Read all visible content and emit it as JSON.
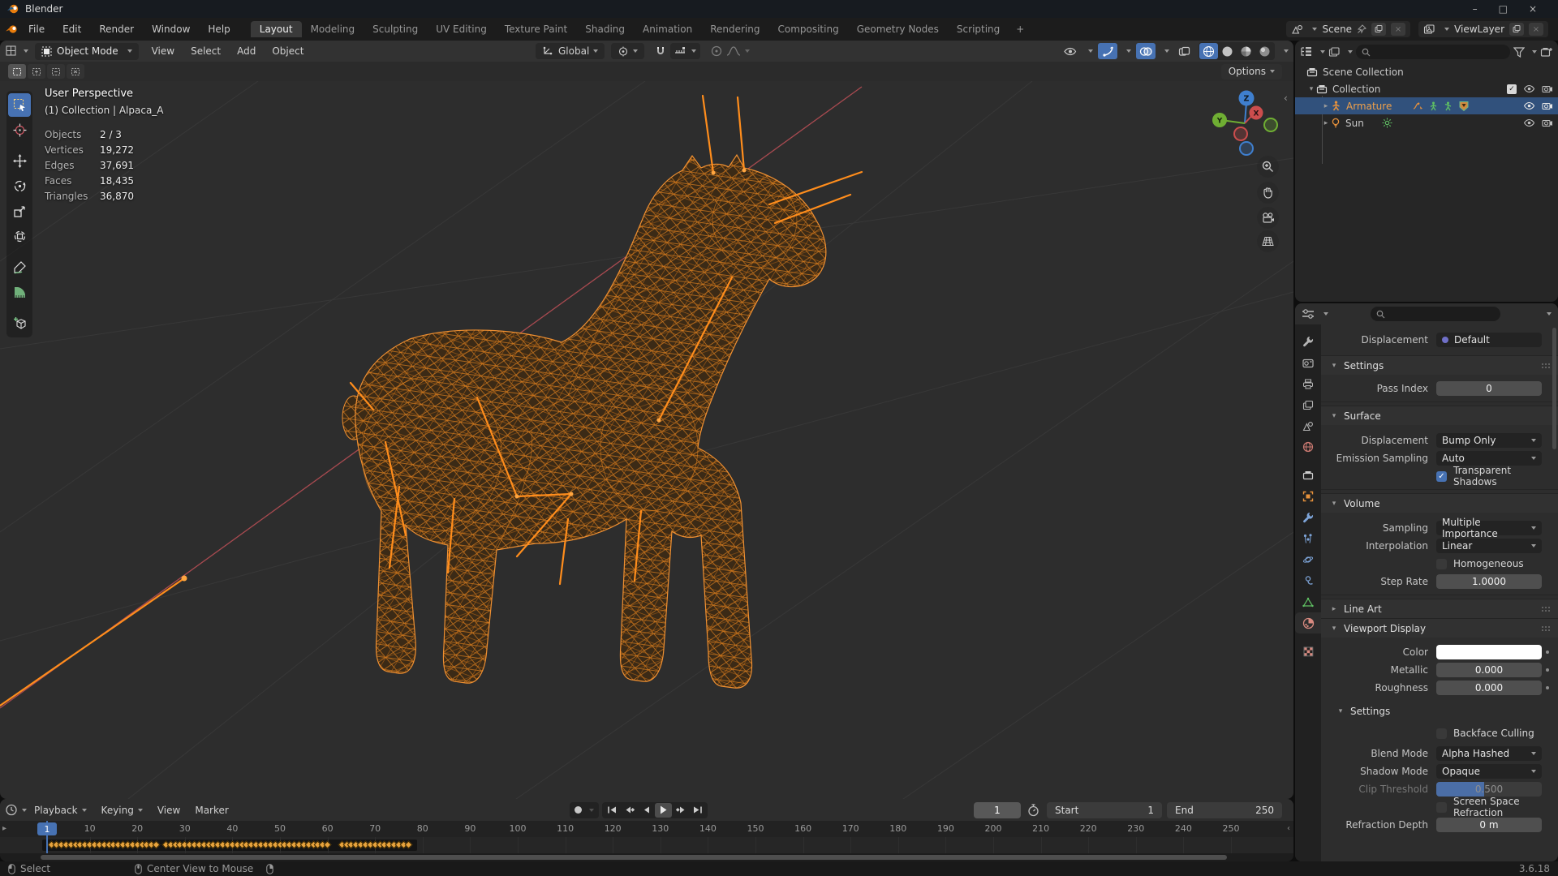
{
  "titlebar": {
    "title": "Blender",
    "minimize": "–",
    "maximize": "□",
    "close": "×"
  },
  "topbar": {
    "menus": [
      "File",
      "Edit",
      "Render",
      "Window",
      "Help"
    ],
    "workspaces": [
      "Layout",
      "Modeling",
      "Sculpting",
      "UV Editing",
      "Texture Paint",
      "Shading",
      "Animation",
      "Rendering",
      "Compositing",
      "Geometry Nodes",
      "Scripting"
    ],
    "active_workspace": "Layout",
    "new_workspace": "+",
    "scene_selector": {
      "value": "Scene"
    },
    "view_layer_selector": {
      "value": "ViewLayer"
    }
  },
  "viewport_header": {
    "mode": "Object Mode",
    "menus": [
      "View",
      "Select",
      "Add",
      "Object"
    ],
    "orientation": "Global",
    "options_button": "Options"
  },
  "viewport": {
    "overlay": {
      "title": "User Perspective",
      "context": "(1) Collection | Alpaca_A",
      "stats": [
        {
          "label": "Objects",
          "value": "2 / 3"
        },
        {
          "label": "Vertices",
          "value": "19,272"
        },
        {
          "label": "Edges",
          "value": "37,691"
        },
        {
          "label": "Faces",
          "value": "18,435"
        },
        {
          "label": "Triangles",
          "value": "36,870"
        }
      ]
    },
    "gizmo": {
      "axis_up": "Z",
      "axis_right": "X",
      "axis_left": "Y"
    }
  },
  "outliner": {
    "rows": [
      {
        "label": "Scene Collection"
      },
      {
        "label": "Collection"
      },
      {
        "label": "Armature",
        "selected": true
      },
      {
        "label": "Sun"
      }
    ]
  },
  "properties": {
    "displacement": {
      "label": "Displacement",
      "value": "Default"
    },
    "settings_panel": {
      "title": "Settings",
      "pass_index_label": "Pass Index",
      "pass_index_value": "0"
    },
    "surface": {
      "title": "Surface",
      "displacement_label": "Displacement",
      "displacement_value": "Bump Only",
      "emission_label": "Emission Sampling",
      "emission_value": "Auto",
      "transparent_shadows_label": "Transparent Shadows",
      "transparent_shadows_checked": true
    },
    "volume": {
      "title": "Volume",
      "sampling_label": "Sampling",
      "sampling_value": "Multiple Importance",
      "interpolation_label": "Interpolation",
      "interpolation_value": "Linear",
      "homogeneous_label": "Homogeneous",
      "homogeneous_checked": false,
      "step_rate_label": "Step Rate",
      "step_rate_value": "1.0000"
    },
    "line_art": {
      "title": "Line Art"
    },
    "viewport_display": {
      "title": "Viewport Display",
      "color_label": "Color",
      "metallic_label": "Metallic",
      "metallic_value": "0.000",
      "roughness_label": "Roughness",
      "roughness_value": "0.000",
      "settings": {
        "title": "Settings",
        "backface_label": "Backface Culling",
        "blend_label": "Blend Mode",
        "blend_value": "Alpha Hashed",
        "shadow_label": "Shadow Mode",
        "shadow_value": "Opaque",
        "clip_label": "Clip Threshold",
        "clip_value": "0.500",
        "ssr_label": "Screen Space Refraction",
        "refraction_label": "Refraction Depth",
        "refraction_value": "0 m"
      }
    }
  },
  "timeline": {
    "menus": [
      "Playback",
      "Keying",
      "View",
      "Marker"
    ],
    "current_frame": "1",
    "start_label": "Start",
    "start_value": "1",
    "end_label": "End",
    "end_value": "250",
    "ticks": [
      10,
      20,
      30,
      40,
      50,
      60,
      70,
      80,
      90,
      100,
      110,
      120,
      130,
      140,
      150,
      160,
      170,
      180,
      190,
      200,
      210,
      220,
      230,
      240,
      250
    ],
    "keyframe_segments": [
      [
        2,
        24
      ],
      [
        26,
        60
      ],
      [
        63,
        77
      ]
    ]
  },
  "statusbar": {
    "hints": [
      {
        "button": "left",
        "label": "Select"
      },
      {
        "button": "middle",
        "label": "Center View to Mouse"
      },
      {
        "button": "right",
        "label": ""
      }
    ],
    "version": "3.6.18"
  },
  "colors": {
    "accent": "#4772b3",
    "selection_text": "#f0a04a",
    "keyframe": "#e8a33d",
    "wireframe": "#e0821f",
    "bone": "#ff8d1c",
    "axis_x": "#cc4d4d",
    "axis_y": "#6fae33",
    "axis_z": "#3f7fce"
  }
}
